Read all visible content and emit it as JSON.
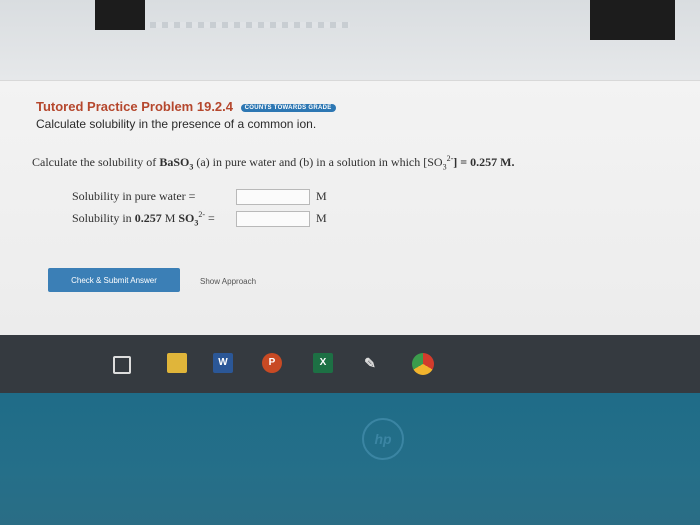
{
  "problem": {
    "title": "Tutored Practice Problem 19.2.4",
    "badge": "COUNTS TOWARDS GRADE",
    "subtitle": "Calculate solubility in the presence of a common ion."
  },
  "question": {
    "text_a": "Calculate the solubility of ",
    "compound": "BaSO",
    "compound_sub": "3",
    "text_b": " (a) in pure water and (b) in a solution in which [SO",
    "ion_sub": "3",
    "ion_sup": "2-",
    "text_c": "] = 0.257 M."
  },
  "rows": [
    {
      "label": "Solubility in pure water =",
      "value": "",
      "unit": "M"
    },
    {
      "label_a": "Solubility in ",
      "label_b": "0.257",
      "label_c": " M ",
      "label_d": "SO",
      "label_sub": "3",
      "label_sup": "2-",
      "label_e": " =",
      "value": "",
      "unit": "M"
    }
  ],
  "buttons": {
    "submit": "Check & Submit Answer",
    "approach": "Show Approach"
  },
  "taskbar": {
    "word": "W",
    "ppt": "P",
    "excel": "X"
  },
  "bezel": {
    "logo": "hp"
  }
}
